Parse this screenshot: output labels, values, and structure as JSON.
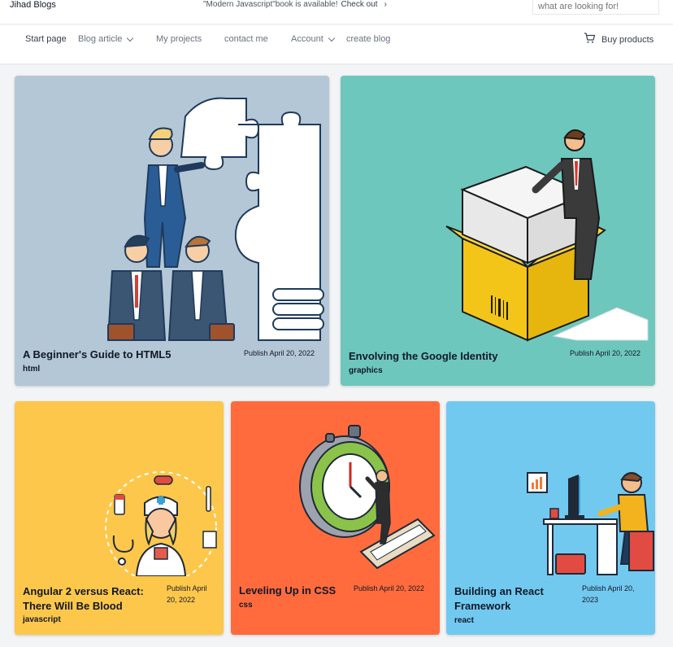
{
  "topbar": {
    "brand": "Jihad Blogs",
    "announcement": "\"Modern Javascript\"book is available!",
    "announcement_link": "Check out",
    "search_placeholder": "what are looking for!"
  },
  "nav": {
    "items": [
      {
        "label": "Start page"
      },
      {
        "label": "Blog article"
      },
      {
        "label": "My projects"
      },
      {
        "label": "contact me"
      },
      {
        "label": "Account"
      },
      {
        "label": "create blog"
      }
    ],
    "buy_label": "Buy products"
  },
  "cards": [
    {
      "title": "A Beginner's Guide to HTML5",
      "tag": "html",
      "date": "Publish April 20, 2022",
      "bg": "#b4c7d6"
    },
    {
      "title": "Envolving the Google Identity",
      "tag": "graphics",
      "date": "Publish April 20, 2022",
      "bg": "#6ec7bd"
    },
    {
      "title_lines": [
        "Angular 2 versus React:",
        "There Will Be Blood"
      ],
      "tag": "javascript",
      "date_lines": [
        "Publish April",
        "20, 2022"
      ],
      "bg": "#fdc74b"
    },
    {
      "title": "Leveling Up in CSS",
      "tag": "css",
      "date": "Publish April 20, 2022",
      "bg": "#ff6b3d"
    },
    {
      "title_lines": [
        "Building an React",
        "Framework"
      ],
      "tag": "react",
      "date_lines": [
        "Publish April 20,",
        "2023"
      ],
      "bg": "#72c9ef"
    }
  ],
  "icons": [
    "chevron-right-icon",
    "chevron-down-icon",
    "cart-icon"
  ]
}
